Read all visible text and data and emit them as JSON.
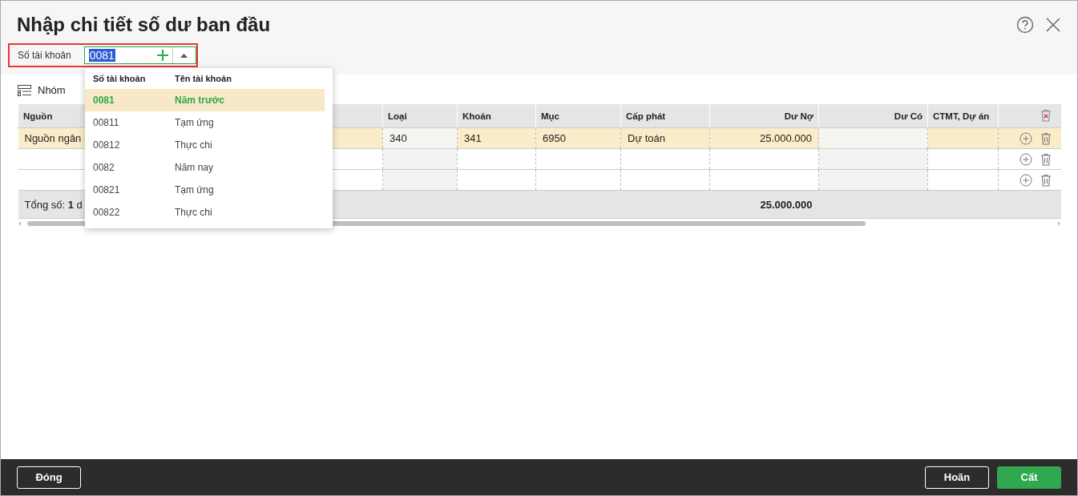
{
  "window": {
    "title": "Nhập chi tiết số dư ban đầu"
  },
  "account_field": {
    "label": "Số tài khoản",
    "value": "0081"
  },
  "dropdown": {
    "columns": [
      "Số tài khoản",
      "Tên tài khoản"
    ],
    "rows": [
      {
        "code": "0081",
        "name": "Năm trước",
        "selected": true
      },
      {
        "code": "00811",
        "name": "Tạm ứng",
        "selected": false
      },
      {
        "code": "00812",
        "name": "Thực chi",
        "selected": false
      },
      {
        "code": "0082",
        "name": "Năm nay",
        "selected": false
      },
      {
        "code": "00821",
        "name": "Tạm ứng",
        "selected": false
      },
      {
        "code": "00822",
        "name": "Thực chi",
        "selected": false
      }
    ]
  },
  "group_button": "Nhóm",
  "table": {
    "columns": [
      {
        "label": "Nguồn",
        "kind": "editable"
      },
      {
        "label": "Loại",
        "kind": "readonly"
      },
      {
        "label": "Khoản",
        "kind": "editable"
      },
      {
        "label": "Mục",
        "kind": "editable"
      },
      {
        "label": "Cấp phát",
        "kind": "editable"
      },
      {
        "label": "Dư Nợ",
        "kind": "editable"
      },
      {
        "label": "Dư Có",
        "kind": "readonly"
      },
      {
        "label": "CTMT, Dự án",
        "kind": "editable"
      }
    ],
    "rows": [
      {
        "selected": true,
        "cells": [
          "Nguồn ngân",
          "340",
          "341",
          "6950",
          "Dự toán",
          "25.000.000"
        ]
      },
      {
        "selected": false
      },
      {
        "selected": false
      }
    ],
    "footer": {
      "label": "Tổng số: **1** d",
      "total": "25.000.000"
    }
  },
  "buttons": [
    {
      "label": "Đóng",
      "kind": "outline"
    },
    {
      "label": "Hoãn",
      "kind": "outline"
    },
    {
      "label": "Cất",
      "kind": "primary"
    }
  ]
}
